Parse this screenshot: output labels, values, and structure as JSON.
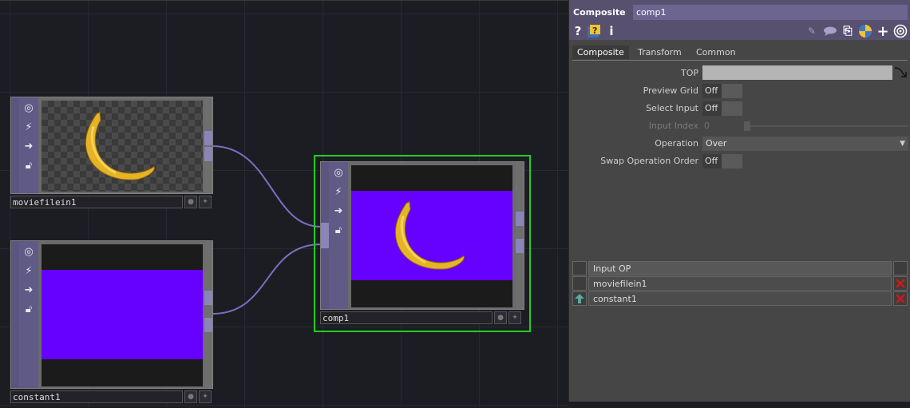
{
  "network": {
    "nodes": [
      {
        "name": "moviefilein1",
        "viewer": "banana-on-transparent"
      },
      {
        "name": "constant1",
        "viewer_color": "#6600ff"
      },
      {
        "name": "comp1",
        "selected": true,
        "viewer_color": "#6600ff"
      }
    ],
    "accent_selected": "#22cc22",
    "wire_color": "#7a6fc0"
  },
  "params": {
    "operator_type": "Composite",
    "operator_name": "comp1",
    "header_icons": [
      "help-icon",
      "help-python-icon",
      "info-icon",
      "edit-icon",
      "comment-icon",
      "clone-icon",
      "python-icon",
      "add-icon",
      "viewer-icon"
    ],
    "tabs": [
      "Composite",
      "Transform",
      "Common"
    ],
    "active_tab": "Composite",
    "fields": {
      "top": {
        "label": "TOP",
        "value": ""
      },
      "preview_grid": {
        "label": "Preview Grid",
        "value": "Off"
      },
      "select_input": {
        "label": "Select Input",
        "value": "Off"
      },
      "input_index": {
        "label": "Input Index",
        "value": "0"
      },
      "operation": {
        "label": "Operation",
        "value": "Over"
      },
      "swap_order": {
        "label": "Swap Operation Order",
        "value": "Off"
      }
    },
    "input_table": {
      "header": "Input OP",
      "rows": [
        "moviefilein1",
        "constant1"
      ]
    }
  }
}
